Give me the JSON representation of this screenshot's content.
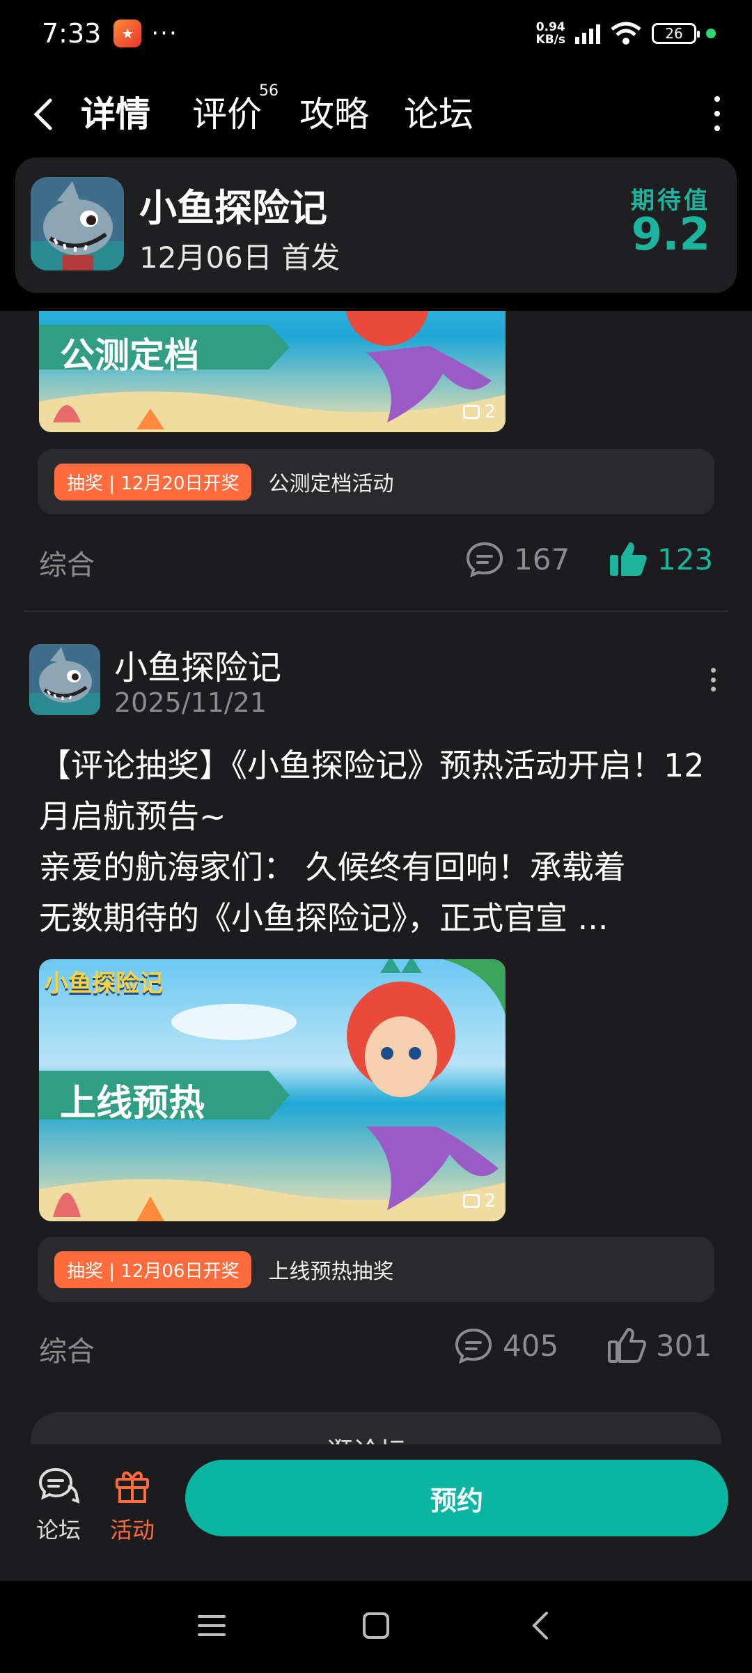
{
  "status_bar": {
    "time": "7:33",
    "dots": "···",
    "net_speed_value": "0.94",
    "net_speed_unit": "KB/s",
    "battery": "26"
  },
  "nav": {
    "tabs": [
      {
        "label": "详情",
        "active": true
      },
      {
        "label": "评价",
        "badge": "56"
      },
      {
        "label": "攻略"
      },
      {
        "label": "论坛"
      }
    ]
  },
  "game": {
    "name": "小鱼探险记",
    "release": "12月06日 首发",
    "expect_label": "期待值",
    "expect_value": "9.2"
  },
  "posts": [
    {
      "banner_text": "公测定档",
      "image_count": "2",
      "lottery_tag": "抽奖 | 12月20日开奖",
      "lottery_text": "公测定档活动",
      "category": "综合",
      "comments": "167",
      "likes": "123",
      "liked": true
    },
    {
      "author": "小鱼探险记",
      "date": "2025/11/21",
      "title": "【评论抽奖】《小鱼探险记》预热活动开启！12 月启航预告~",
      "body_line1": "亲爱的航海家们： 久候终有回响！承载着",
      "body_line2": "无数期待的《小鱼探险记》，正式官宣 ...",
      "banner_logo": "小鱼探险记",
      "banner_text": "上线预热",
      "image_count": "2",
      "lottery_tag": "抽奖 | 12月06日开奖",
      "lottery_text": "上线预热抽奖",
      "category": "综合",
      "comments": "405",
      "likes": "301",
      "liked": false
    }
  ],
  "forum_button": "逛论坛 ›",
  "actions": {
    "forum_label": "论坛",
    "activity_label": "活动",
    "reserve_label": "预约"
  },
  "colors": {
    "accent": "#1db49e",
    "reserve": "#0ab5a2",
    "lottery": "#ff6b3d",
    "activity": "#ff6b3d"
  }
}
